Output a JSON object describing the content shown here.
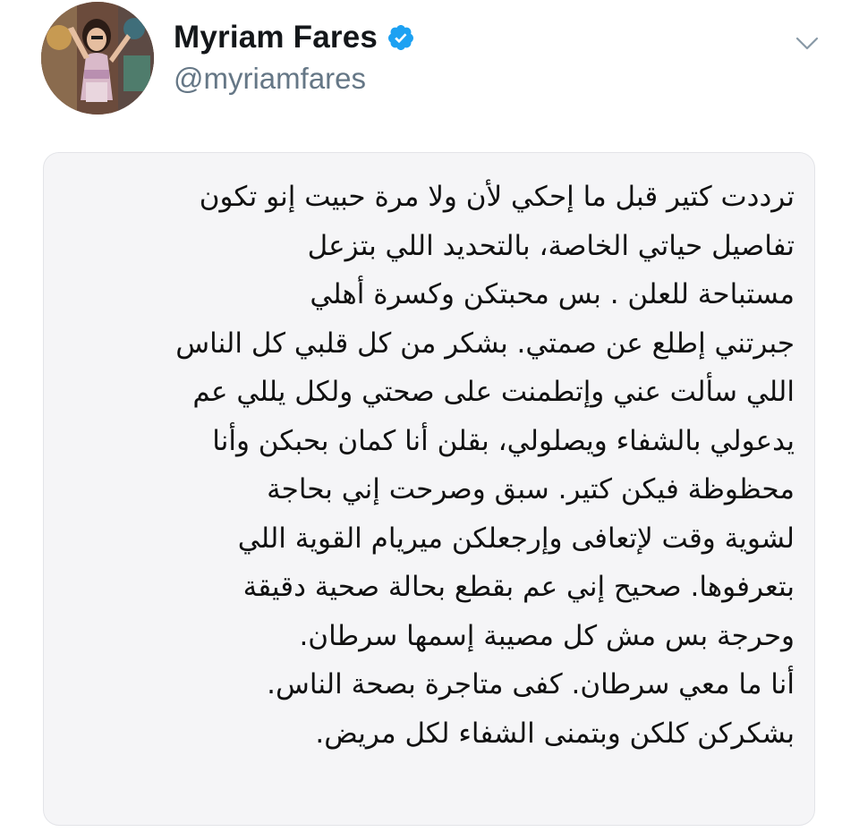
{
  "tweet": {
    "author": {
      "display_name": "Myriam Fares",
      "handle": "@myriamfares",
      "verified": true,
      "avatar_icon": "profile-photo",
      "verified_icon": "verified-badge-icon",
      "verified_color": "#1da1f2"
    },
    "menu_icon": "chevron-down-icon",
    "body_lines": [
      "ترددت كتير قبل ما إحكي لأن ولا مرة حبيت إنو تكون",
      "تفاصيل حياتي الخاصة، بالتحديد اللي بتزعل",
      "مستباحة للعلن . بس محبتكن وكسرة أهلي",
      "جبرتني إطلع عن صمتي. بشكر من كل قلبي كل الناس",
      "اللي سألت عني وإتطمنت على صحتي ولكل يللي عم",
      "يدعولي بالشفاء ويصلولي، بقلن أنا كمان بحبكن وأنا",
      "محظوظة فيكن كتير. سبق وصرحت إني بحاجة",
      "لشوية وقت لإتعافى وإرجعلكن ميريام القوية اللي",
      "بتعرفوها. صحيح إني عم بقطع بحالة صحية دقيقة",
      "وحرجة بس مش كل مصيبة إسمها سرطان.",
      "أنا ما معي سرطان. كفى متاجرة بصحة الناس.",
      "بشكركن كلكن وبتمنى الشفاء لكل مريض."
    ]
  },
  "colors": {
    "name_text": "#14171a",
    "handle_text": "#657786",
    "card_background": "#f5f5f7",
    "body_text": "#111111"
  }
}
